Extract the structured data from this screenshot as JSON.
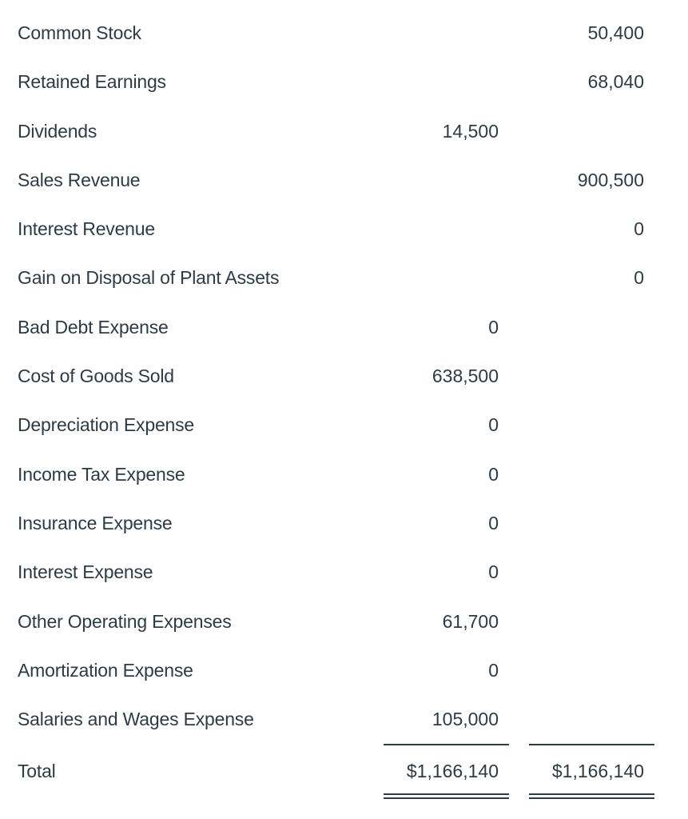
{
  "trial_balance": {
    "rows": [
      {
        "account": "Common Stock",
        "debit": "",
        "credit": "50,400"
      },
      {
        "account": "Retained Earnings",
        "debit": "",
        "credit": "68,040"
      },
      {
        "account": "Dividends",
        "debit": "14,500",
        "credit": ""
      },
      {
        "account": "Sales Revenue",
        "debit": "",
        "credit": "900,500"
      },
      {
        "account": "Interest Revenue",
        "debit": "",
        "credit": "0"
      },
      {
        "account": "Gain on Disposal of Plant Assets",
        "debit": "",
        "credit": "0"
      },
      {
        "account": "Bad Debt Expense",
        "debit": "0",
        "credit": ""
      },
      {
        "account": "Cost of Goods Sold",
        "debit": "638,500",
        "credit": ""
      },
      {
        "account": "Depreciation Expense",
        "debit": "0",
        "credit": ""
      },
      {
        "account": "Income Tax Expense",
        "debit": "0",
        "credit": ""
      },
      {
        "account": "Insurance Expense",
        "debit": "0",
        "credit": ""
      },
      {
        "account": "Interest Expense",
        "debit": "0",
        "credit": ""
      },
      {
        "account": "Other Operating Expenses",
        "debit": "61,700",
        "credit": ""
      },
      {
        "account": "Amortization Expense",
        "debit": "0",
        "credit": ""
      },
      {
        "account": "Salaries and Wages Expense",
        "debit": "105,000",
        "credit": ""
      }
    ],
    "total": {
      "label": "Total",
      "debit": "$1,166,140",
      "credit": "$1,166,140"
    }
  },
  "colors": {
    "text": "#2d3b45",
    "background": "#ffffff"
  }
}
